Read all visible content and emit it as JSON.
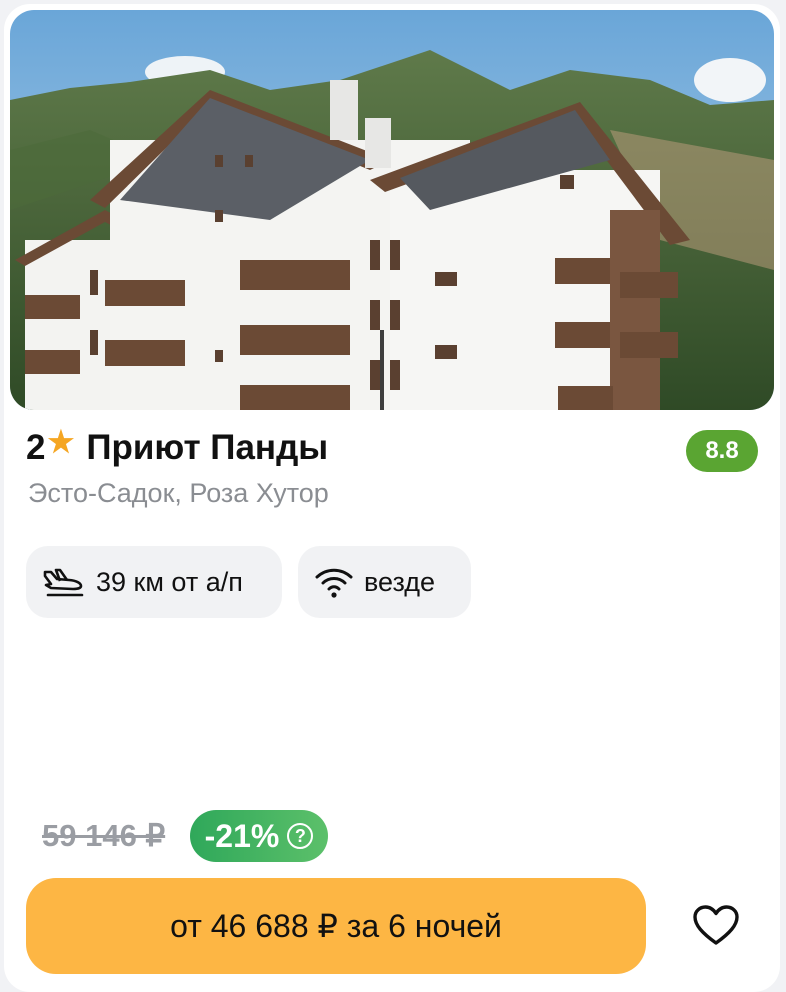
{
  "hotel": {
    "stars": "2",
    "star_icon": "star-icon",
    "name": "Приют Панды",
    "rating": "8.8",
    "location": "Эсто-Садок, Роза Хутор",
    "photo_icon": "hotel-photo"
  },
  "features": [
    {
      "icon": "plane-landing-icon",
      "label": "39 км от а/п"
    },
    {
      "icon": "wifi-icon",
      "label": "везде"
    }
  ],
  "pricing": {
    "old_price": "59 146 ₽",
    "discount": "-21%",
    "discount_help_icon": "question-icon",
    "cta_label": "от 46 688 ₽ за 6 ночей"
  },
  "favorite_icon": "heart-icon",
  "colors": {
    "rating_bg": "#5aa532",
    "discount_bg": "#2fa85a",
    "cta_bg": "#fdb644",
    "star": "#f5a623",
    "muted_text": "#8a8d92"
  }
}
